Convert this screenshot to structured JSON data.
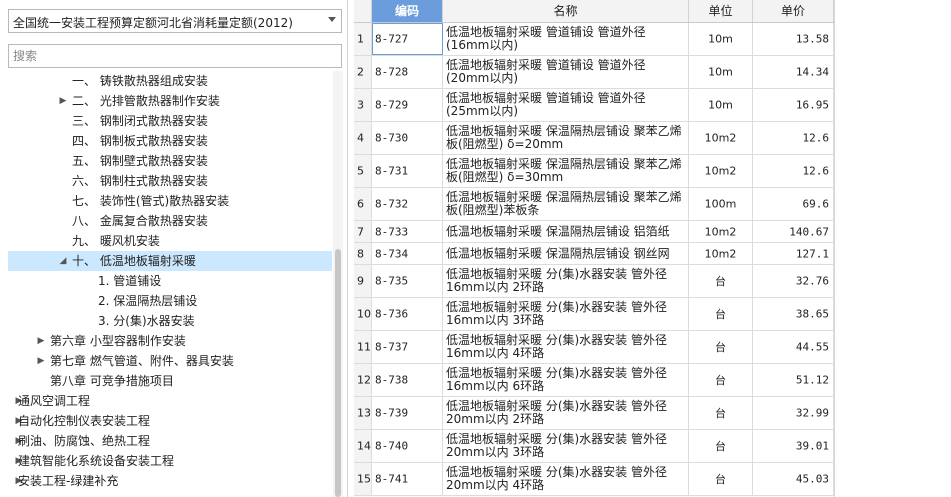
{
  "quota_select": {
    "value": "全国统一安装工程预算定额河北省消耗量定额(2012)"
  },
  "search": {
    "placeholder": "搜索"
  },
  "tree": [
    {
      "indent": 1,
      "label": "一、 铸铁散热器组成安装",
      "toggle": ""
    },
    {
      "indent": 1,
      "label": "二、 光排管散热器制作安装",
      "toggle": "▶"
    },
    {
      "indent": 1,
      "label": "三、 钢制闭式散热器安装",
      "toggle": ""
    },
    {
      "indent": 1,
      "label": "四、 钢制板式散热器安装",
      "toggle": ""
    },
    {
      "indent": 1,
      "label": "五、 钢制壁式散热器安装",
      "toggle": ""
    },
    {
      "indent": 1,
      "label": "六、 钢制柱式散热器安装",
      "toggle": ""
    },
    {
      "indent": 1,
      "label": "七、 装饰性(管式)散热器安装",
      "toggle": ""
    },
    {
      "indent": 1,
      "label": "八、 金属复合散热器安装",
      "toggle": ""
    },
    {
      "indent": 1,
      "label": "九、 暖风机安装",
      "toggle": ""
    },
    {
      "indent": 1,
      "label": "十、 低温地板辐射采暖",
      "toggle": "◢",
      "selected": true
    },
    {
      "indent": 2,
      "label": "1. 管道铺设",
      "toggle": ""
    },
    {
      "indent": 2,
      "label": "2. 保温隔热层铺设",
      "toggle": ""
    },
    {
      "indent": 2,
      "label": "3. 分(集)水器安装",
      "toggle": ""
    },
    {
      "indent": 0.5,
      "label": "第六章 小型容器制作安装",
      "toggle": "▶"
    },
    {
      "indent": 0.5,
      "label": "第七章 燃气管道、附件、器具安装",
      "toggle": "▶"
    },
    {
      "indent": 0.5,
      "label": "第八章 可竞争措施项目",
      "toggle": ""
    },
    {
      "indent": 0,
      "label": "通风空调工程",
      "toggle": "▶"
    },
    {
      "indent": 0,
      "label": "自动化控制仪表安装工程",
      "toggle": "▶"
    },
    {
      "indent": 0,
      "label": "刷油、防腐蚀、绝热工程",
      "toggle": "▶"
    },
    {
      "indent": 0,
      "label": "建筑智能化系统设备安装工程",
      "toggle": "▶"
    },
    {
      "indent": 0,
      "label": "安装工程-绿建补充",
      "toggle": "▶"
    }
  ],
  "table": {
    "headers": {
      "code": "编码",
      "name": "名称",
      "unit": "单位",
      "price": "单价"
    },
    "rows": [
      {
        "idx": "1",
        "code": "8-727",
        "name": "低温地板辐射采暖 管道铺设 管道外径(16mm以内)",
        "unit": "10m",
        "price": "13.58"
      },
      {
        "idx": "2",
        "code": "8-728",
        "name": "低温地板辐射采暖 管道铺设 管道外径(20mm以内)",
        "unit": "10m",
        "price": "14.34"
      },
      {
        "idx": "3",
        "code": "8-729",
        "name": "低温地板辐射采暖 管道铺设 管道外径(25mm以内)",
        "unit": "10m",
        "price": "16.95"
      },
      {
        "idx": "4",
        "code": "8-730",
        "name": "低温地板辐射采暖 保温隔热层铺设 聚苯乙烯板(阻燃型) δ=20mm",
        "unit": "10m2",
        "price": "12.6"
      },
      {
        "idx": "5",
        "code": "8-731",
        "name": "低温地板辐射采暖 保温隔热层铺设 聚苯乙烯板(阻燃型) δ=30mm",
        "unit": "10m2",
        "price": "12.6"
      },
      {
        "idx": "6",
        "code": "8-732",
        "name": "低温地板辐射采暖 保温隔热层铺设 聚苯乙烯板(阻燃型)苯板条",
        "unit": "100m",
        "price": "69.6"
      },
      {
        "idx": "7",
        "code": "8-733",
        "name": "低温地板辐射采暖 保温隔热层铺设 铝箔纸",
        "unit": "10m2",
        "price": "140.67"
      },
      {
        "idx": "8",
        "code": "8-734",
        "name": "低温地板辐射采暖 保温隔热层铺设 钢丝网",
        "unit": "10m2",
        "price": "127.1"
      },
      {
        "idx": "9",
        "code": "8-735",
        "name": "低温地板辐射采暖 分(集)水器安装 管外径16mm以内 2环路",
        "unit": "台",
        "price": "32.76"
      },
      {
        "idx": "10",
        "code": "8-736",
        "name": "低温地板辐射采暖 分(集)水器安装 管外径16mm以内 3环路",
        "unit": "台",
        "price": "38.65"
      },
      {
        "idx": "11",
        "code": "8-737",
        "name": "低温地板辐射采暖 分(集)水器安装 管外径16mm以内 4环路",
        "unit": "台",
        "price": "44.55"
      },
      {
        "idx": "12",
        "code": "8-738",
        "name": "低温地板辐射采暖 分(集)水器安装 管外径16mm以内 6环路",
        "unit": "台",
        "price": "51.12"
      },
      {
        "idx": "13",
        "code": "8-739",
        "name": "低温地板辐射采暖 分(集)水器安装 管外径20mm以内 2环路",
        "unit": "台",
        "price": "32.99"
      },
      {
        "idx": "14",
        "code": "8-740",
        "name": "低温地板辐射采暖 分(集)水器安装 管外径20mm以内 3环路",
        "unit": "台",
        "price": "39.01"
      },
      {
        "idx": "15",
        "code": "8-741",
        "name": "低温地板辐射采暖 分(集)水器安装 管外径20mm以内 4环路",
        "unit": "台",
        "price": "45.03"
      }
    ]
  }
}
